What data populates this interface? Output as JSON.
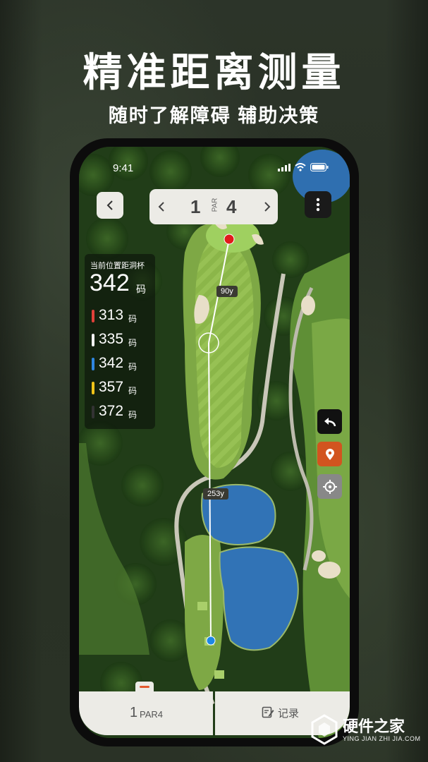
{
  "promo": {
    "headline": "精准距离测量",
    "subheadline": "随时了解障碍 辅助决策"
  },
  "status_bar": {
    "time": "9:41"
  },
  "hole_nav": {
    "hole_number": "1",
    "par_label": "PAR",
    "par_value": "4"
  },
  "distance_panel": {
    "title": "当前位置距洞杯",
    "main_value": "342",
    "main_unit": "码",
    "tees": [
      {
        "value": "313",
        "unit": "码",
        "color": "#e0413a"
      },
      {
        "value": "335",
        "unit": "码",
        "color": "#f2f2f2"
      },
      {
        "value": "342",
        "unit": "码",
        "color": "#2f86e0"
      },
      {
        "value": "357",
        "unit": "码",
        "color": "#f0c419"
      },
      {
        "value": "372",
        "unit": "码",
        "color": "#333333"
      }
    ]
  },
  "map_labels": {
    "upper_distance": "90y",
    "lower_distance": "253y"
  },
  "side_buttons": {
    "back_color": "#111111",
    "pin_color": "#d2541f",
    "target_color": "#888888"
  },
  "bottom_bar": {
    "hole": "1",
    "par": "PAR4",
    "record": "记录"
  },
  "watermark": {
    "name": "硬件之家",
    "url": "YING JIAN ZHI JIA.COM"
  },
  "colors": {
    "accent": "#e35a2f",
    "panel": "#ecebe6"
  }
}
